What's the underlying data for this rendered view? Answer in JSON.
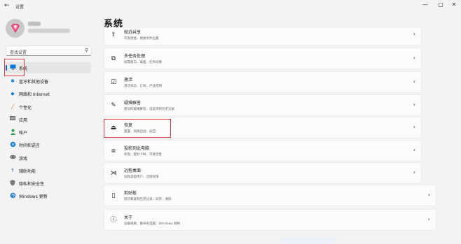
{
  "titlebar": {
    "title": "设置",
    "back_glyph": "←",
    "minimize_glyph": "—",
    "maximize_glyph": "▢",
    "close_glyph": "✕"
  },
  "search": {
    "placeholder": "查找设置",
    "icon": "search-icon"
  },
  "sidebar": {
    "items": [
      {
        "label": "系统",
        "icon": "monitor-icon",
        "active": true
      },
      {
        "label": "蓝牙和其他设备",
        "icon": "bluetooth-icon"
      },
      {
        "label": "网络和 Internet",
        "icon": "wifi-icon"
      },
      {
        "label": "个性化",
        "icon": "brush-icon"
      },
      {
        "label": "应用",
        "icon": "apps-icon"
      },
      {
        "label": "帐户",
        "icon": "person-icon"
      },
      {
        "label": "时间和语言",
        "icon": "globe-clock-icon"
      },
      {
        "label": "游戏",
        "icon": "gamepad-icon"
      },
      {
        "label": "辅助功能",
        "icon": "accessibility-icon"
      },
      {
        "label": "隐私和安全性",
        "icon": "shield-icon"
      },
      {
        "label": "Windows 更新",
        "icon": "update-icon"
      }
    ]
  },
  "main": {
    "title": "系统",
    "cards": [
      {
        "title": "就近共享",
        "desc": "可发现性、接收文件位置",
        "icon": "share-icon"
      },
      {
        "title": "多任务处理",
        "desc": "贴靠窗口、桌面、任务切换",
        "icon": "multitask-icon"
      },
      {
        "title": "激活",
        "desc": "激活状态、订阅、产品密钥",
        "icon": "check-circle-icon"
      },
      {
        "title": "疑难解答",
        "desc": "建议的疑难解答、首选项和历史记录",
        "icon": "wrench-icon"
      },
      {
        "title": "恢复",
        "desc": "重置、高级启动、返回",
        "icon": "recovery-icon"
      },
      {
        "title": "投影到此电脑",
        "desc": "权限、配对 PIN、可发现性",
        "icon": "project-icon"
      },
      {
        "title": "远程桌面",
        "desc": "远程桌面用户、连接权限",
        "icon": "remote-icon"
      },
      {
        "title": "剪贴板",
        "desc": "剪切和复制历史记录、同步、清除",
        "icon": "clipboard-icon"
      },
      {
        "title": "关于",
        "desc": "设备规格、重命名电脑、Windows 规格",
        "icon": "info-icon"
      }
    ]
  },
  "colors": {
    "accent": "#0067c0",
    "highlight_box": "#e03a3a",
    "background": "#f3f3f3",
    "card": "#fbfbfb"
  }
}
